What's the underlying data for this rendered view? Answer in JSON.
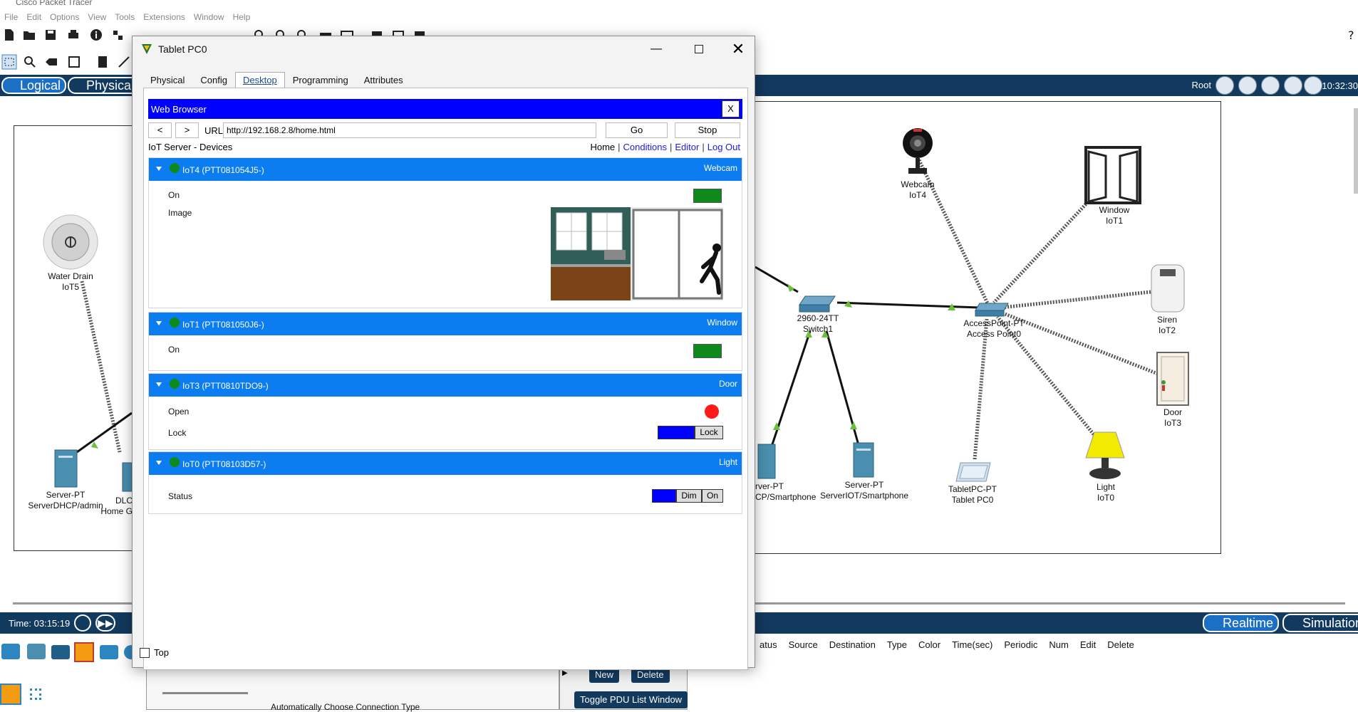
{
  "app": {
    "title": "Cisco Packet Tracer",
    "menu": [
      "File",
      "Edit",
      "Options",
      "View",
      "Tools",
      "Extensions",
      "Window",
      "Help"
    ],
    "help_icon": "?"
  },
  "modes": {
    "logical": "Logical",
    "physical": "Physical"
  },
  "topbar": {
    "root_label": "Root",
    "clock": "10:32:30"
  },
  "devices": {
    "water_drain": {
      "type": "Water Drain",
      "name": "IoT5"
    },
    "server_dhcp": {
      "type": "Server-PT",
      "name": "ServerDHCP/admin"
    },
    "dlc": {
      "type": "DLC",
      "name": "Home G"
    },
    "webcam": {
      "type": "Webcam",
      "name": "IoT4"
    },
    "window": {
      "type": "Window",
      "name": "IoT1"
    },
    "siren": {
      "type": "Siren",
      "name": "IoT2"
    },
    "door": {
      "type": "Door",
      "name": "IoT3"
    },
    "light": {
      "type": "Light",
      "name": "IoT0"
    },
    "switch": {
      "type": "2960-24TT",
      "name": "Switch1"
    },
    "access_point": {
      "type": "AccessPoint-PT",
      "name": "Access Point0"
    },
    "server_partial": {
      "type": "rver-PT",
      "name": "CP/Smartphone"
    },
    "server_iot": {
      "type": "Server-PT",
      "name": "ServerIOT/Smartphone"
    },
    "tablet": {
      "type": "TabletPC-PT",
      "name": "Tablet PC0"
    }
  },
  "bottom": {
    "time": "Time: 03:15:19",
    "realtime": "Realtime",
    "simulation": "Simulation",
    "pdu_columns": [
      "atus",
      "Source",
      "Destination",
      "Type",
      "Color",
      "Time(sec)",
      "Periodic",
      "Num",
      "Edit",
      "Delete"
    ],
    "new": "New",
    "delete": "Delete",
    "toggle_pdu": "Toggle PDU List Window",
    "auto_connection": "Automatically Choose Connection Type"
  },
  "window": {
    "title": "Tablet PC0",
    "tabs": [
      "Physical",
      "Config",
      "Desktop",
      "Programming",
      "Attributes"
    ],
    "active_tab": "Desktop",
    "top_checkbox": "Top"
  },
  "browser": {
    "title": "Web Browser",
    "close": "X",
    "back": "<",
    "forward": ">",
    "url_label": "URL",
    "url": "http://192.168.2.8/home.html",
    "go": "Go",
    "stop": "Stop",
    "heading": "IoT Server - Devices",
    "nav": {
      "home": "Home",
      "conditions": "Conditions",
      "editor": "Editor",
      "logout": "Log Out",
      "sep": "|"
    }
  },
  "iot_devices": [
    {
      "name": "IoT4 (PTT081054J5-)",
      "type": "Webcam",
      "rows": [
        "On",
        "Image"
      ]
    },
    {
      "name": "IoT1 (PTT081050J6-)",
      "type": "Window",
      "rows": [
        "On"
      ]
    },
    {
      "name": "IoT3 (PTT0810TDO9-)",
      "type": "Door",
      "rows": [
        "Open",
        "Lock"
      ],
      "lock_btn": "Lock"
    },
    {
      "name": "IoT0 (PTT08103D57-)",
      "type": "Light",
      "rows": [
        "Status"
      ],
      "dim_btn": "Dim",
      "on_btn": "On"
    }
  ],
  "colors": {
    "accent_blue": "#0b7df0",
    "nav_bar": "#12395e",
    "status_green": "#0d8a1b",
    "status_red": "#ff1a1a"
  }
}
